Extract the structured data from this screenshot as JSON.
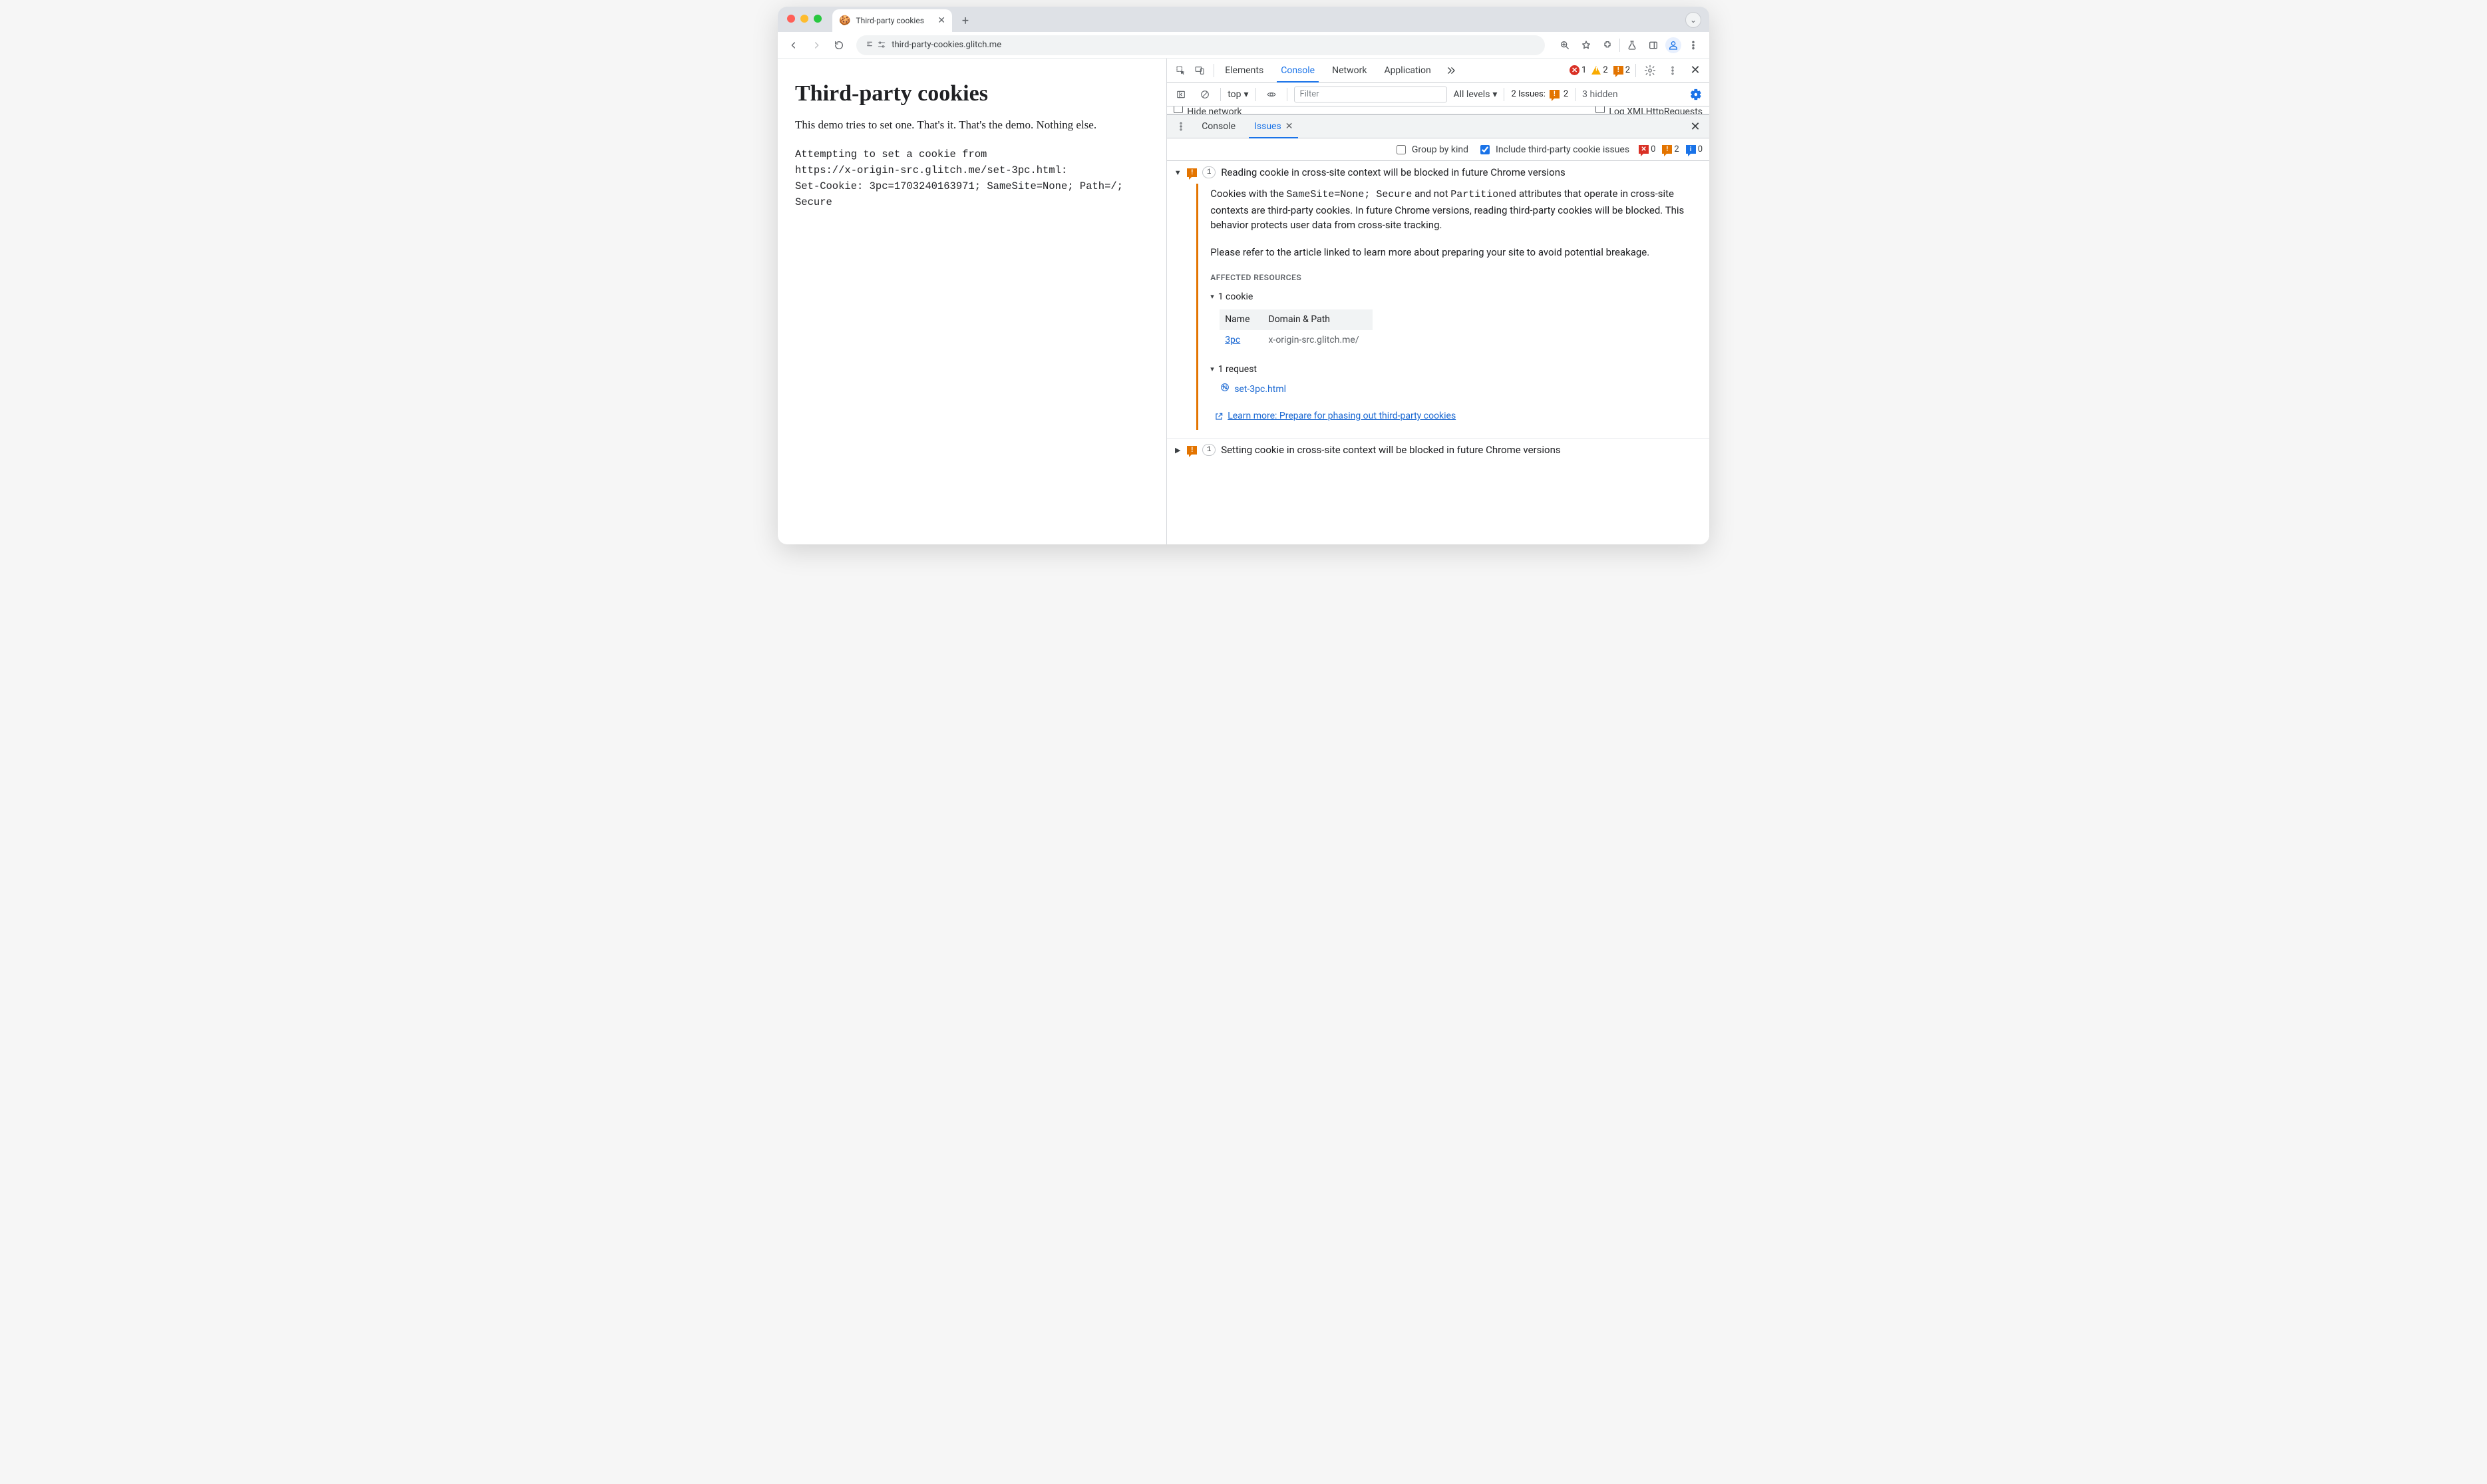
{
  "browser": {
    "tab_title": "Third-party cookies",
    "url": "third-party-cookies.glitch.me"
  },
  "page": {
    "h1": "Third-party cookies",
    "intro": "This demo tries to set one. That's it. That's the demo. Nothing else.",
    "pre": "Attempting to set a cookie from\nhttps://x-origin-src.glitch.me/set-3pc.html:\nSet-Cookie: 3pc=1703240163971; SameSite=None; Path=/; Secure"
  },
  "devtools": {
    "tabs": {
      "elements": "Elements",
      "console": "Console",
      "network": "Network",
      "application": "Application"
    },
    "status": {
      "errors": "1",
      "warnings": "2",
      "issues": "2"
    },
    "filterbar": {
      "context": "top",
      "filter_placeholder": "Filter",
      "levels": "All levels",
      "issues_label": "2 Issues:",
      "issues_count": "2",
      "hidden": "3 hidden"
    },
    "checks": {
      "hide_network": "Hide network",
      "xhr": "Log XMLHttpRequests"
    },
    "drawer": {
      "console": "Console",
      "issues": "Issues"
    },
    "issues_toolbar": {
      "group": "Group by kind",
      "include_3p": "Include third-party cookie issues",
      "err": "0",
      "warn": "2",
      "info": "0"
    },
    "issue1": {
      "count": "1",
      "title": "Reading cookie in cross-site context will be blocked in future Chrome versions",
      "p1_a": "Cookies with the ",
      "p1_code1": "SameSite=None; Secure",
      "p1_b": " and not ",
      "p1_code2": "Partitioned",
      "p1_c": " attributes that operate in cross-site contexts are third-party cookies. In future Chrome versions, reading third-party cookies will be blocked. This behavior protects user data from cross-site tracking.",
      "p2": "Please refer to the article linked to learn more about preparing your site to avoid potential breakage.",
      "affected_hdr": "Affected Resources",
      "cookies_summary": "1 cookie",
      "table": {
        "col_name": "Name",
        "col_domain": "Domain & Path",
        "row_name": "3pc",
        "row_domain": "x-origin-src.glitch.me/"
      },
      "requests_summary": "1 request",
      "request_link": "set-3pc.html",
      "learn_more": "Learn more: Prepare for phasing out third-party cookies"
    },
    "issue2": {
      "count": "1",
      "title": "Setting cookie in cross-site context will be blocked in future Chrome versions"
    }
  }
}
